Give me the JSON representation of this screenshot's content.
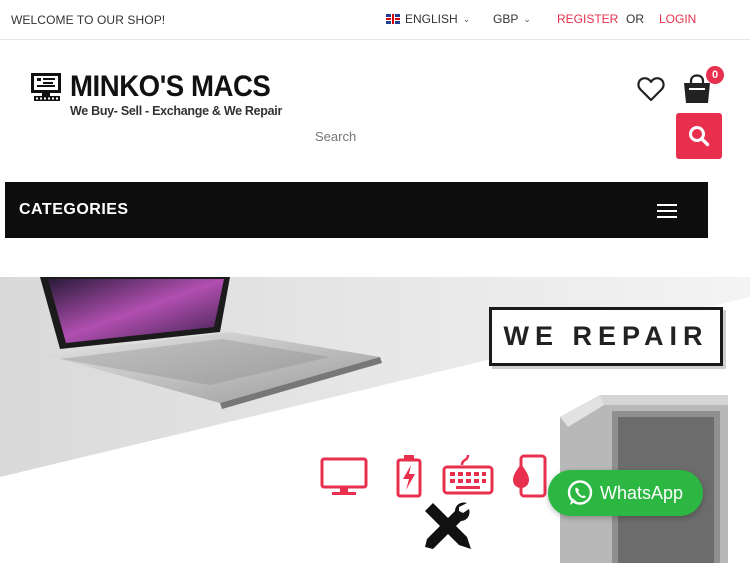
{
  "topbar": {
    "welcome": "WELCOME TO OUR SHOP!",
    "language": "ENGLISH",
    "currency": "GBP",
    "register": "REGISTER",
    "or": "OR",
    "login": "LOGIN"
  },
  "header": {
    "logo_name": "MINKO'S MACS",
    "logo_tagline": "We Buy- Sell - Exchange & We Repair",
    "cart_count": "0",
    "search_placeholder": "Search"
  },
  "categories": {
    "label": "CATEGORIES"
  },
  "banner": {
    "headline": "WE REPAIR",
    "icons": [
      "monitor-icon",
      "battery-icon",
      "keyboard-icon",
      "liquid-damage-icon",
      "tools-icon"
    ]
  },
  "whatsapp": {
    "label": "WhatsApp"
  },
  "colors": {
    "accent": "#e8304e",
    "dark_bar": "#0d0d0d",
    "whatsapp": "#2bb741"
  }
}
